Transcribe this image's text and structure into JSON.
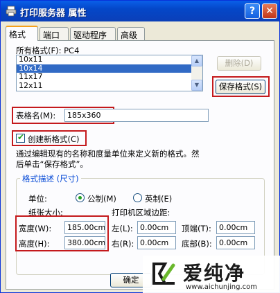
{
  "window": {
    "title": "打印服务器 属性",
    "help_label": "?",
    "close_label": "✕"
  },
  "tabs": [
    {
      "label": "格式",
      "active": true
    },
    {
      "label": "端口",
      "active": false
    },
    {
      "label": "驱动程序",
      "active": false
    },
    {
      "label": "高级",
      "active": false
    }
  ],
  "forms": {
    "all_forms_label": "所有格式(F): PC4",
    "list_items": [
      "10x11",
      "10x14",
      "11x17",
      "12x11"
    ],
    "selected_index": 1,
    "delete_button": "删除(D)",
    "save_button": "保存格式(S)",
    "form_name_label": "表格名(M):",
    "form_name_value": "185x360",
    "create_new_label": "创建新格式(C)",
    "create_new_checked": true,
    "description_line1": "通过编辑现有的名称和度量单位来定义新的格式。然",
    "description_line2": "后单击“保存格式”。"
  },
  "measurements": {
    "group_title": "格式描述 (尺寸)",
    "units_label": "单位:",
    "metric_label": "公制(M)",
    "english_label": "英制(E)",
    "metric_selected": true,
    "paper_size_label": "纸张大小:",
    "margins_label": "打印机区域边距:",
    "width_label": "宽度(W):",
    "width_value": "185.00cm",
    "height_label": "高度(H):",
    "height_value": "380.00cm",
    "left_label": "左(L):",
    "left_value": "0.00cm",
    "right_label": "右(R):",
    "right_value": "0.00cm",
    "top_label": "顶端(T):",
    "top_value": "0.00cm",
    "bottom_label": "底部(B):",
    "bottom_value": "0.00cm"
  },
  "footer": {
    "ok_button": "确定"
  },
  "watermark": {
    "brand": "爱纯净",
    "url": "www.aichunjing.com"
  },
  "colors": {
    "titlebar": "#0447c8",
    "selection": "#316ac5",
    "highlight_box": "#c4191c",
    "group_title": "#0046d5"
  }
}
